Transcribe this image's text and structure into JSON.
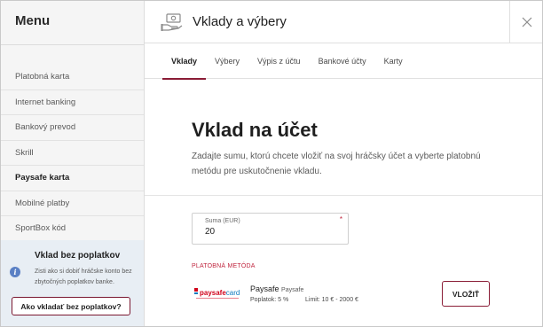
{
  "sidebar": {
    "title": "Menu",
    "items": [
      {
        "label": "Platobná karta",
        "active": false
      },
      {
        "label": "Internet banking",
        "active": false
      },
      {
        "label": "Bankový prevod",
        "active": false
      },
      {
        "label": "Skrill",
        "active": false
      },
      {
        "label": "Paysafe karta",
        "active": true
      },
      {
        "label": "Mobilné platby",
        "active": false
      },
      {
        "label": "SportBox kód",
        "active": false
      }
    ],
    "promo": {
      "title": "Vklad bez poplatkov",
      "text": "Zisti ako si dobiť hráčske konto bez zbytočných poplatkov banke.",
      "button_label": "Ako vkladať bez poplatkov?",
      "icon": "info-icon"
    }
  },
  "header": {
    "title": "Vklady a výbery",
    "icon": "money-hand-icon",
    "close_icon": "close-icon"
  },
  "tabs": [
    {
      "label": "Vklady",
      "active": true
    },
    {
      "label": "Výbery",
      "active": false
    },
    {
      "label": "Výpis z účtu",
      "active": false
    },
    {
      "label": "Bankové účty",
      "active": false
    },
    {
      "label": "Karty",
      "active": false
    }
  ],
  "hero": {
    "title": "Vklad na účet",
    "text": "Zadajte sumu, ktorú chcete vložiť na svoj hráčsky účet a vyberte platobnú metódu pre uskutočnenie vkladu."
  },
  "amount": {
    "label": "Suma (EUR)",
    "value": "20",
    "required_mark": "*"
  },
  "payment": {
    "heading": "PLATOBNÁ METÓDA",
    "logo_text_a": "paysafe",
    "logo_text_b": "card",
    "name": "Paysafe",
    "provider": "Paysafe",
    "fee": "Poplatok: 5 %",
    "limit": "Limit: 10 € - 2000 €",
    "button_label": "VLOŽIŤ"
  },
  "colors": {
    "accent": "#8a1c36",
    "required": "#c0263f",
    "sidebar_bg": "#f5f5f5",
    "promo_bg": "#e8eef4",
    "paysafe_red": "#d0021b",
    "paysafe_blue": "#0b79bf"
  }
}
